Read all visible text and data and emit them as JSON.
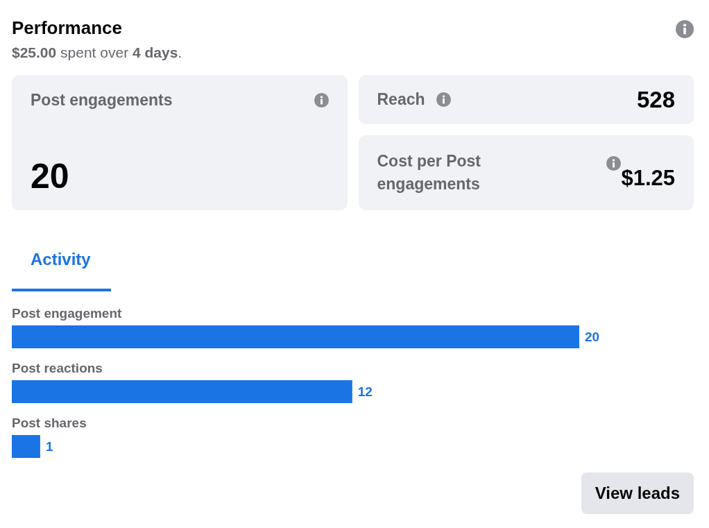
{
  "header": {
    "title": "Performance",
    "subtitle": "**$25.00** spent over **4 days**."
  },
  "metrics": [
    {
      "kind": "tall",
      "label": "Post engagements",
      "value": "20"
    },
    {
      "kind": "inline",
      "label": "Reach",
      "value": "528"
    },
    {
      "kind": "wrapped",
      "label": "Cost per Post engagements",
      "value": "$1.25"
    }
  ],
  "tabs": [
    {
      "label": "Activity",
      "selected": true
    }
  ],
  "activity": {
    "chart_data": {
      "type": "bar",
      "orientation": "horizontal",
      "categories": [
        "Post engagement",
        "Post reactions",
        "Post shares"
      ],
      "values": [
        20,
        12,
        1
      ],
      "data_labels": true
    }
  },
  "button": {
    "label": "View leads"
  }
}
